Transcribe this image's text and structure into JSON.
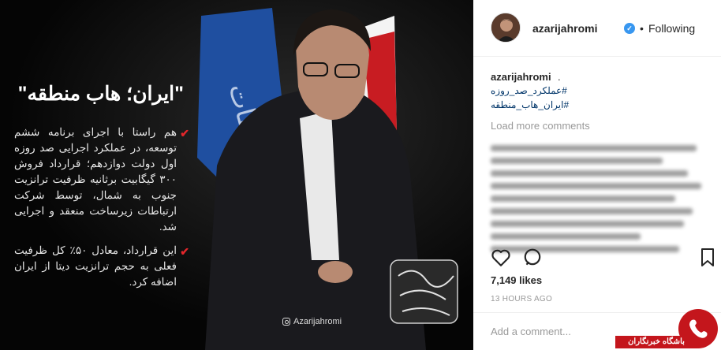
{
  "post_image": {
    "headline": "\"ایران؛ هاب منطقه\"",
    "bullets": [
      "هم راستا با اجرای برنامه ششم توسعه، در عملکرد اجرایی صد روزه اول دولت دوازدهم؛ قرارداد فروش ۳۰۰ گیگابیت برثانیه ظرفیت ترانزیت جنوب به شمال، توسط شرکت ارتباطات زیرساخت منعقد و اجرایی شد.",
      "این قرارداد، معادل ۵۰٪ کل ظرفیت فعلی به حجم ترانزیت دیتا از ایران اضافه کرد."
    ],
    "handle": "Azarijahromi",
    "signature": "محمد جواد آذری جهرمی"
  },
  "header": {
    "username": "azarijahromi",
    "separator": "•",
    "follow_status": "Following"
  },
  "caption": {
    "username": "azarijahromi",
    "text": ".",
    "hashtags": [
      "#عملکرد_صد_روزه",
      "#ایران_هاب_منطقه"
    ]
  },
  "load_more": "Load more comments",
  "likes": "7,149 likes",
  "timestamp": "13 HOURS AGO",
  "add_comment_placeholder": "Add a comment...",
  "watermark": "باشگاه خبرنگاران",
  "colors": {
    "accent_red": "#e3262b",
    "link": "#003569",
    "verified": "#3897f0",
    "muted": "#999999"
  }
}
